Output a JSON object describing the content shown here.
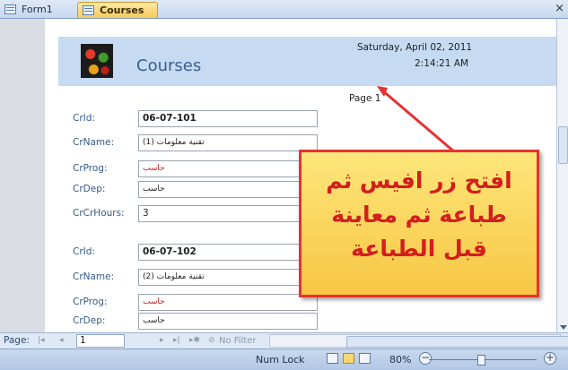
{
  "tabs": [
    {
      "label": "Form1",
      "active": false
    },
    {
      "label": "Courses",
      "active": true
    }
  ],
  "close_glyph": "×",
  "report": {
    "title": "Courses",
    "date": "Saturday, April 02, 2011",
    "time": "2:14:21 AM",
    "page_label": "Page 1",
    "labels": {
      "crid": "CrId:",
      "crname": "CrName:",
      "crprog": "CrProg:",
      "crdep": "CrDep:",
      "crcrhours": "CrCrHours:"
    },
    "records": [
      {
        "crid": "06-07-101",
        "crname": "تقنية معلومات (1)",
        "crprog": "حاسب",
        "crdep": "حاسب",
        "crcrhours": "3"
      },
      {
        "crid": "06-07-102",
        "crname": "تقنية معلومات (2)",
        "crprog": "حاسب",
        "crdep": "حاسب"
      }
    ]
  },
  "annotation": {
    "lines": [
      "افتح زر افيس ثم",
      "طباعة ثم معاينة",
      "قبل الطباعة"
    ],
    "border_color": "#e53232",
    "text_color": "#d21e1e",
    "fill_color": "#f9d45c"
  },
  "navigation": {
    "label": "Page:",
    "value": "1",
    "first": "|◂",
    "prev": "◂",
    "next": "▸",
    "last": "▸|",
    "new": "▸✱",
    "no_filter": "No Filter"
  },
  "status": {
    "num_lock": "Num Lock",
    "zoom": "80%",
    "zoom_out": "−",
    "zoom_in": "+"
  }
}
